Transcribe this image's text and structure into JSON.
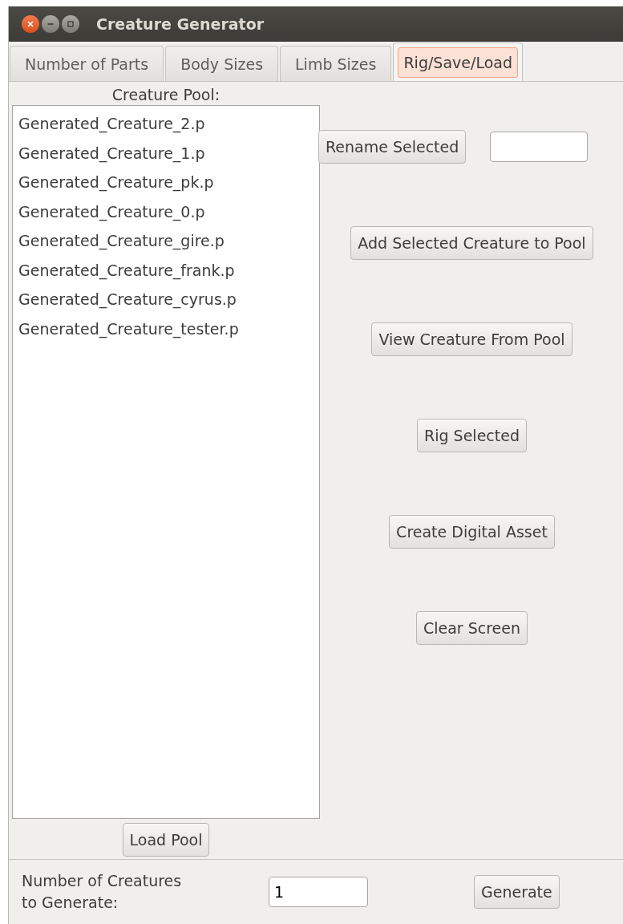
{
  "window": {
    "title": "Creature Generator"
  },
  "tabs": [
    {
      "label": "Number of Parts",
      "selected": false
    },
    {
      "label": "Body Sizes",
      "selected": false
    },
    {
      "label": "Limb Sizes",
      "selected": false
    },
    {
      "label": "Rig/Save/Load",
      "selected": true
    }
  ],
  "pool": {
    "label": "Creature Pool:",
    "items": [
      "Generated_Creature_2.p",
      "Generated_Creature_1.p",
      "Generated_Creature_pk.p",
      "Generated_Creature_0.p",
      "Generated_Creature_gire.p",
      "Generated_Creature_frank.p",
      "Generated_Creature_cyrus.p",
      "Generated_Creature_tester.p"
    ],
    "load_button": "Load Pool"
  },
  "actions": [
    {
      "kind": "rename",
      "label": "Rename Selected"
    },
    {
      "kind": "button",
      "label": "Add Selected Creature to Pool"
    },
    {
      "kind": "button",
      "label": "View Creature From Pool"
    },
    {
      "kind": "button",
      "label": "Rig Selected"
    },
    {
      "kind": "button",
      "label": "Create Digital Asset"
    },
    {
      "kind": "button",
      "label": "Clear Screen"
    }
  ],
  "footer": {
    "label": "Number of Creatures\nto Generate:",
    "value": "1",
    "button": "Generate"
  }
}
